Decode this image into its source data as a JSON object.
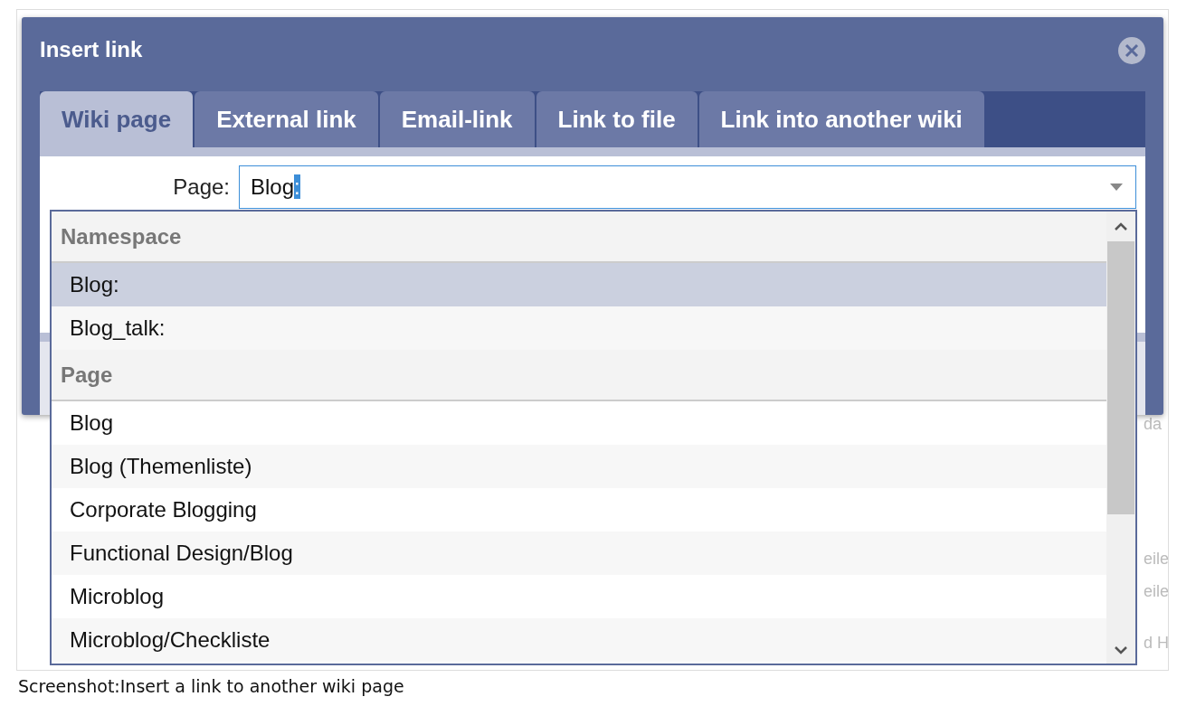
{
  "dialog": {
    "title": "Insert link"
  },
  "tabs": [
    {
      "label": "Wiki page",
      "selected": true
    },
    {
      "label": "External link",
      "selected": false
    },
    {
      "label": "Email-link",
      "selected": false
    },
    {
      "label": "Link to file",
      "selected": false
    },
    {
      "label": "Link into another wiki",
      "selected": false
    }
  ],
  "page_field": {
    "label": "Page:",
    "value": "Blog",
    "selected_suffix": ":"
  },
  "dropdown": {
    "groups": [
      {
        "heading": "Namespace",
        "items": [
          {
            "label": "Blog:",
            "selected": true
          },
          {
            "label": "Blog_talk:",
            "selected": false
          }
        ]
      },
      {
        "heading": "Page",
        "items": [
          {
            "label": "Blog",
            "selected": false
          },
          {
            "label": "Blog (Themenliste)",
            "selected": false
          },
          {
            "label": "Corporate Blogging",
            "selected": false
          },
          {
            "label": "Functional Design/Blog",
            "selected": false
          },
          {
            "label": "Microblog",
            "selected": false
          },
          {
            "label": "Microblog/Checkliste",
            "selected": false
          }
        ]
      }
    ]
  },
  "background_fragments": [
    "da",
    "eile",
    "eile",
    "d H"
  ],
  "caption": "Screenshot:Insert a link to another wiki page"
}
